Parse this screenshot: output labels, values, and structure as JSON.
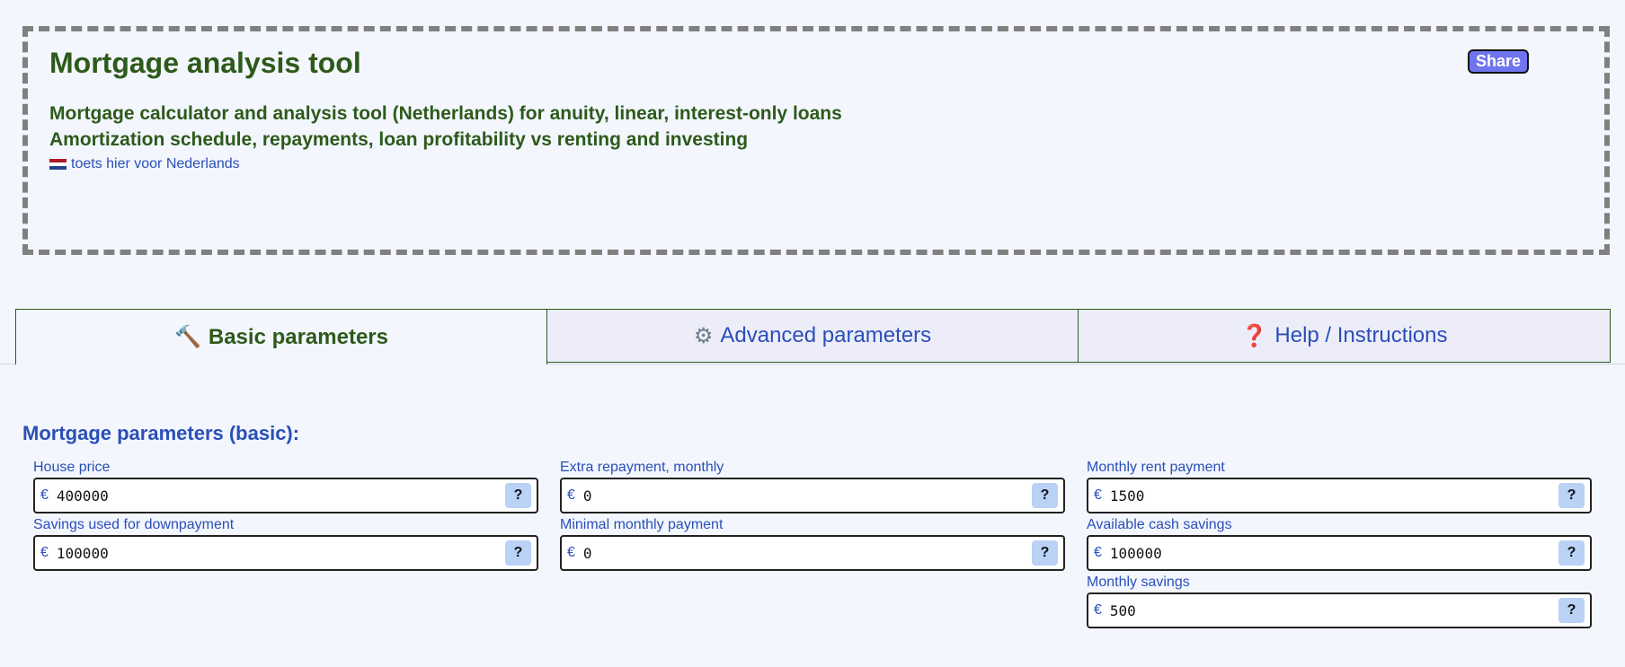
{
  "header": {
    "title": "Mortgage analysis tool",
    "subtitle_line1": "Mortgage calculator and analysis tool (Netherlands) for anuity, linear, interest-only loans",
    "subtitle_line2": "Amortization schedule, repayments, loan profitability vs renting and investing",
    "language_link": "toets hier voor Nederlands",
    "language_flag_icon": "netherlands-flag-icon",
    "share_label": "Share"
  },
  "tabs": [
    {
      "label": "Basic parameters",
      "icon": "hammer-icon",
      "active": true
    },
    {
      "label": "Advanced parameters",
      "icon": "gear-icon",
      "active": false
    },
    {
      "label": "Help / Instructions",
      "icon": "question-icon",
      "active": false
    }
  ],
  "section": {
    "title": "Mortgage parameters (basic):"
  },
  "fields": {
    "house_price": {
      "label": "House price",
      "currency": "€",
      "value": "400000",
      "help": "?"
    },
    "savings_downpayment": {
      "label": "Savings used for downpayment",
      "currency": "€",
      "value": "100000",
      "help": "?"
    },
    "extra_repayment": {
      "label": "Extra repayment, monthly",
      "currency": "€",
      "value": "0",
      "help": "?"
    },
    "minimal_payment": {
      "label": "Minimal monthly payment",
      "currency": "€",
      "value": "0",
      "help": "?"
    },
    "monthly_rent": {
      "label": "Monthly rent payment",
      "currency": "€",
      "value": "1500",
      "help": "?"
    },
    "cash_savings": {
      "label": "Available cash savings",
      "currency": "€",
      "value": "100000",
      "help": "?"
    },
    "monthly_savings": {
      "label": "Monthly savings",
      "currency": "€",
      "value": "500",
      "help": "?"
    }
  },
  "colors": {
    "heading_green": "#2d5a1b",
    "link_blue": "#2a4fb8",
    "share_button": "#6f75ee",
    "help_button": "#b9d2f5",
    "page_background": "#f3f6fd",
    "inactive_tab": "#ededfa"
  }
}
